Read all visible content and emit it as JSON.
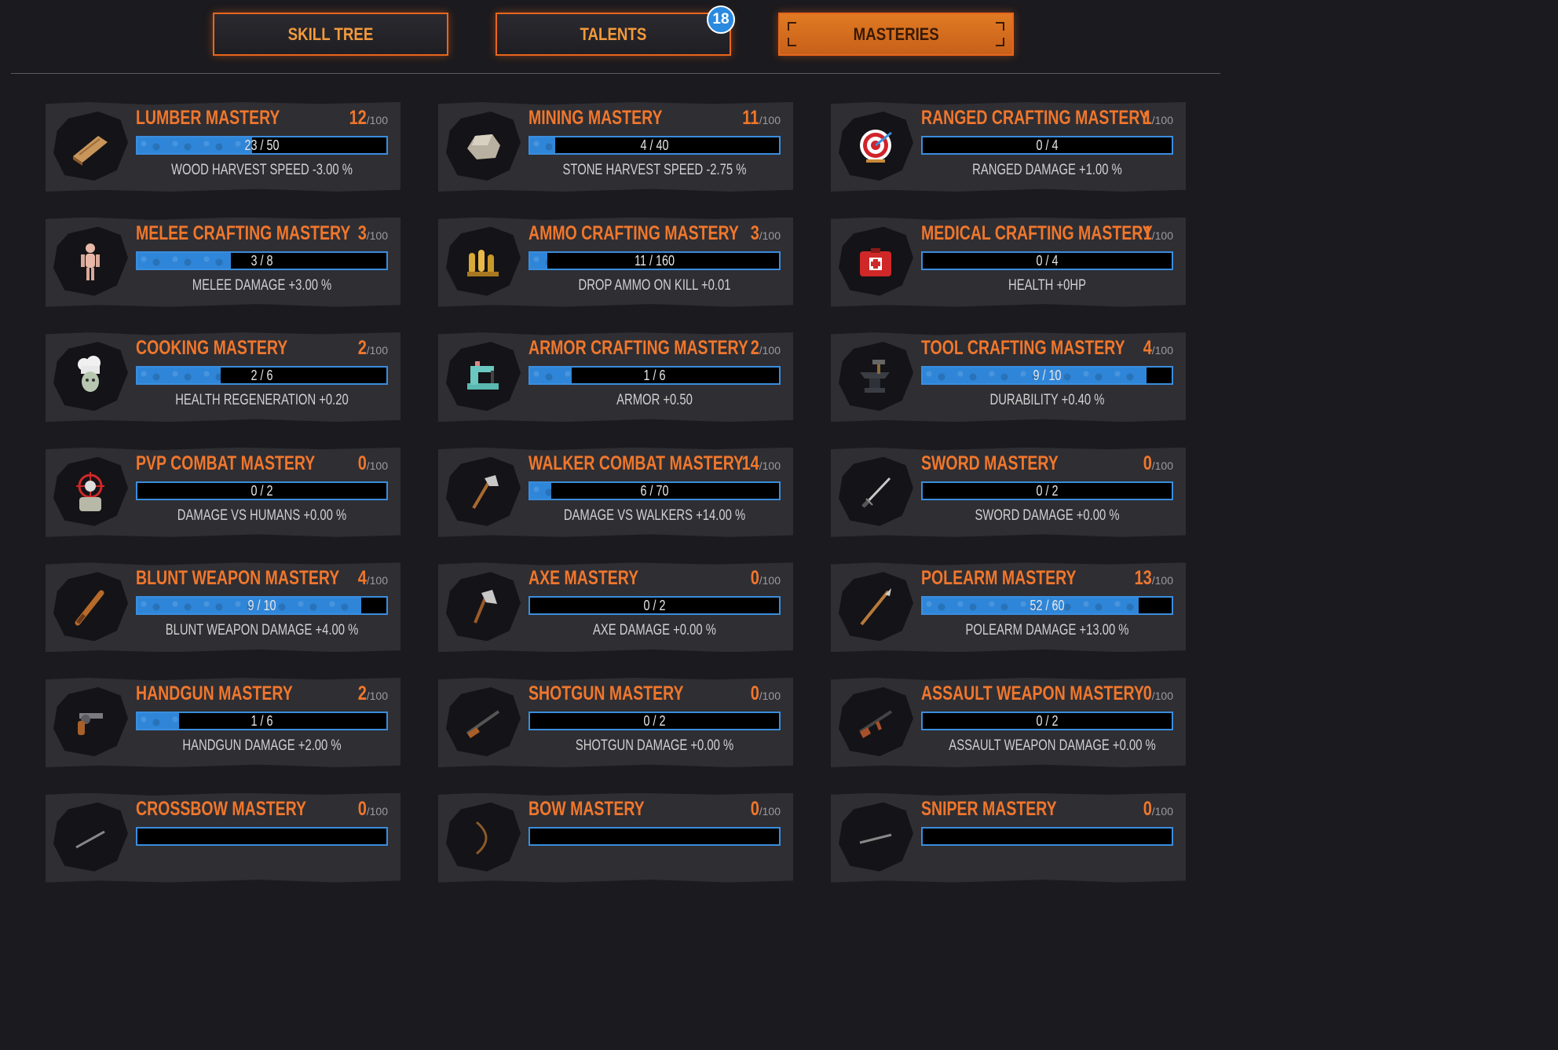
{
  "tabs": [
    {
      "label": "SKILL TREE",
      "active": false
    },
    {
      "label": "TALENTS",
      "active": false,
      "badge": "18"
    },
    {
      "label": "MASTERIES",
      "active": true
    }
  ],
  "max_suffix": "/100",
  "masteries": [
    {
      "name": "LUMBER MASTERY",
      "level": "12",
      "progress": "23 / 50",
      "fraction": 0.46,
      "effect": "WOOD HARVEST SPEED -3.00 %",
      "icon": "lumber-icon"
    },
    {
      "name": "MINING MASTERY",
      "level": "11",
      "progress": "4 / 40",
      "fraction": 0.1,
      "effect": "STONE HARVEST SPEED -2.75 %",
      "icon": "stone-icon"
    },
    {
      "name": "RANGED CRAFTING MASTERY",
      "level": "1",
      "progress": "0 / 4",
      "fraction": 0,
      "effect": "RANGED DAMAGE +1.00 %",
      "icon": "target-icon"
    },
    {
      "name": "MELEE CRAFTING MASTERY",
      "level": "3",
      "progress": "3 / 8",
      "fraction": 0.375,
      "effect": "MELEE DAMAGE +3.00 %",
      "icon": "mannequin-icon"
    },
    {
      "name": "AMMO CRAFTING MASTERY",
      "level": "3",
      "progress": "11 / 160",
      "fraction": 0.069,
      "effect": "DROP AMMO ON KILL +0.01",
      "icon": "ammo-icon"
    },
    {
      "name": "MEDICAL CRAFTING MASTERY",
      "level": "1",
      "progress": "0 / 4",
      "fraction": 0,
      "effect": "HEALTH +0HP",
      "icon": "medkit-icon"
    },
    {
      "name": "COOKING MASTERY",
      "level": "2",
      "progress": "2 / 6",
      "fraction": 0.333,
      "effect": "HEALTH REGENERATION +0.20",
      "icon": "chef-icon"
    },
    {
      "name": "ARMOR CRAFTING MASTERY",
      "level": "2",
      "progress": "1 / 6",
      "fraction": 0.167,
      "effect": "ARMOR +0.50",
      "icon": "sewing-machine-icon"
    },
    {
      "name": "TOOL CRAFTING MASTERY",
      "level": "4",
      "progress": "9 / 10",
      "fraction": 0.9,
      "effect": "DURABILITY +0.40 %",
      "icon": "anvil-icon"
    },
    {
      "name": "PVP COMBAT MASTERY",
      "level": "0",
      "progress": "0 / 2",
      "fraction": 0,
      "effect": "DAMAGE VS HUMANS +0.00 %",
      "icon": "soldier-target-icon"
    },
    {
      "name": "WALKER COMBAT MASTERY",
      "level": "14",
      "progress": "6 / 70",
      "fraction": 0.086,
      "effect": "DAMAGE VS WALKERS +14.00 %",
      "icon": "hatchet-icon"
    },
    {
      "name": "SWORD MASTERY",
      "level": "0",
      "progress": "0 / 2",
      "fraction": 0,
      "effect": "SWORD DAMAGE +0.00 %",
      "icon": "sword-icon"
    },
    {
      "name": "BLUNT WEAPON MASTERY",
      "level": "4",
      "progress": "9 / 10",
      "fraction": 0.9,
      "effect": "BLUNT WEAPON DAMAGE +4.00 %",
      "icon": "club-icon"
    },
    {
      "name": "AXE MASTERY",
      "level": "0",
      "progress": "0 / 2",
      "fraction": 0,
      "effect": "AXE DAMAGE +0.00 %",
      "icon": "axe-icon"
    },
    {
      "name": "POLEARM MASTERY",
      "level": "13",
      "progress": "52 / 60",
      "fraction": 0.867,
      "effect": "POLEARM DAMAGE +13.00 %",
      "icon": "polearm-icon"
    },
    {
      "name": "HANDGUN MASTERY",
      "level": "2",
      "progress": "1 / 6",
      "fraction": 0.167,
      "effect": "HANDGUN DAMAGE +2.00 %",
      "icon": "revolver-icon"
    },
    {
      "name": "SHOTGUN MASTERY",
      "level": "0",
      "progress": "0 / 2",
      "fraction": 0,
      "effect": "SHOTGUN DAMAGE +0.00 %",
      "icon": "shotgun-icon"
    },
    {
      "name": "ASSAULT WEAPON MASTERY",
      "level": "0",
      "progress": "0 / 2",
      "fraction": 0,
      "effect": "ASSAULT WEAPON DAMAGE +0.00 %",
      "icon": "rifle-icon"
    },
    {
      "name": "CROSSBOW MASTERY",
      "level": "0",
      "progress": "",
      "fraction": 0,
      "effect": "",
      "icon": "crossbow-icon"
    },
    {
      "name": "BOW MASTERY",
      "level": "0",
      "progress": "",
      "fraction": 0,
      "effect": "",
      "icon": "bow-icon"
    },
    {
      "name": "SNIPER MASTERY",
      "level": "0",
      "progress": "",
      "fraction": 0,
      "effect": "",
      "icon": "sniper-icon"
    }
  ],
  "colors": {
    "accent": "#f0772c",
    "bar_fill": "#2f86d9",
    "bar_border": "#3a8ddd",
    "badge": "#2a8ae0"
  }
}
